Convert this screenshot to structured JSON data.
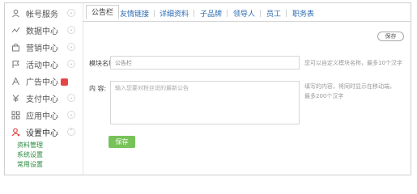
{
  "sidebar": {
    "items": [
      {
        "label": "帐号服务",
        "icon": "person-icon",
        "chevron": "⌄"
      },
      {
        "label": "数据中心",
        "icon": "trend-icon",
        "chevron": "⌄"
      },
      {
        "label": "营销中心",
        "icon": "bag-icon",
        "chevron": "⌄"
      },
      {
        "label": "活动中心",
        "icon": "flag-icon",
        "chevron": "⌄"
      },
      {
        "label": "广告中心",
        "icon": "ad-icon"
      },
      {
        "label": "支付中心",
        "icon": "yen-icon",
        "chevron": "⌄"
      },
      {
        "label": "应用中心",
        "icon": "apps-icon",
        "chevron": "⌄"
      },
      {
        "label": "设置中心",
        "icon": "settings-person-icon",
        "chevron": "⌃"
      }
    ],
    "sub_items": [
      "资料管理",
      "系统设置",
      "常用设置"
    ]
  },
  "tabs": [
    "公告栏",
    "友情链接",
    "详细资料",
    "子品牌",
    "领导人",
    "员工",
    "职务表"
  ],
  "active_tab": "公告栏",
  "save_pill": "保存",
  "form": {
    "name_label": "模块名称:",
    "name_value": "公告栏",
    "name_hint": "您可以自定义模块名称，最多10个汉字",
    "content_label": "内    容:",
    "content_placeholder": "输入您要对粉丝说的最新公告",
    "content_hint_line1": "填写的内容，将同时显示在移动端，",
    "content_hint_line2": "最多200个汉字"
  },
  "submit_label": "保存",
  "colors": {
    "accent_green": "#78c25a",
    "link_blue": "#2b6bb3",
    "badge_red": "#e64545",
    "sub_green": "#2a8a3e"
  }
}
